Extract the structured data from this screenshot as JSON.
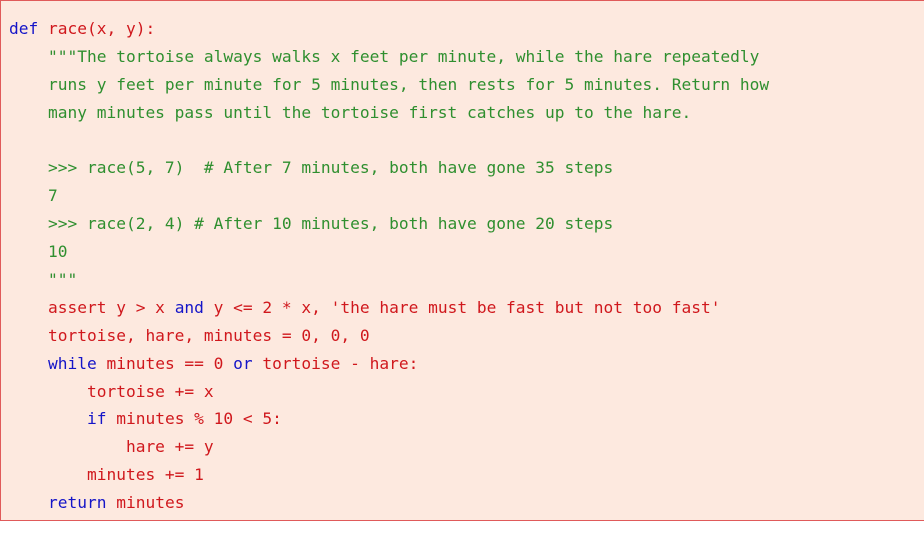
{
  "code": {
    "lines": [
      [
        {
          "t": "kw",
          "s": "def"
        },
        {
          "t": "id",
          "s": " race(x, y):"
        }
      ],
      [
        {
          "t": "doc",
          "s": "    \"\"\"The tortoise always walks x feet per minute, while the hare repeatedly"
        }
      ],
      [
        {
          "t": "doc",
          "s": "    runs y feet per minute for 5 minutes, then rests for 5 minutes. Return how"
        }
      ],
      [
        {
          "t": "doc",
          "s": "    many minutes pass until the tortoise first catches up to the hare."
        }
      ],
      [
        {
          "t": "doc",
          "s": ""
        }
      ],
      [
        {
          "t": "doc",
          "s": "    >>> race(5, 7)  # After 7 minutes, both have gone 35 steps"
        }
      ],
      [
        {
          "t": "doc",
          "s": "    7"
        }
      ],
      [
        {
          "t": "doc",
          "s": "    >>> race(2, 4) # After 10 minutes, both have gone 20 steps"
        }
      ],
      [
        {
          "t": "doc",
          "s": "    10"
        }
      ],
      [
        {
          "t": "doc",
          "s": "    \"\"\""
        }
      ],
      [
        {
          "t": "id",
          "s": "    assert y > x "
        },
        {
          "t": "kw",
          "s": "and"
        },
        {
          "t": "id",
          "s": " y <= 2 * x, 'the hare must be fast but not too fast'"
        }
      ],
      [
        {
          "t": "id",
          "s": "    tortoise, hare, minutes = 0, 0, 0"
        }
      ],
      [
        {
          "t": "kw",
          "s": "    while"
        },
        {
          "t": "id",
          "s": " minutes == 0 "
        },
        {
          "t": "kw",
          "s": "or"
        },
        {
          "t": "id",
          "s": " tortoise - hare:"
        }
      ],
      [
        {
          "t": "id",
          "s": "        tortoise += x"
        }
      ],
      [
        {
          "t": "kw",
          "s": "        if"
        },
        {
          "t": "id",
          "s": " minutes % 10 < 5:"
        }
      ],
      [
        {
          "t": "id",
          "s": "            hare += y"
        }
      ],
      [
        {
          "t": "id",
          "s": "        minutes += 1"
        }
      ],
      [
        {
          "t": "kw",
          "s": "    return"
        },
        {
          "t": "id",
          "s": " minutes"
        }
      ]
    ]
  }
}
